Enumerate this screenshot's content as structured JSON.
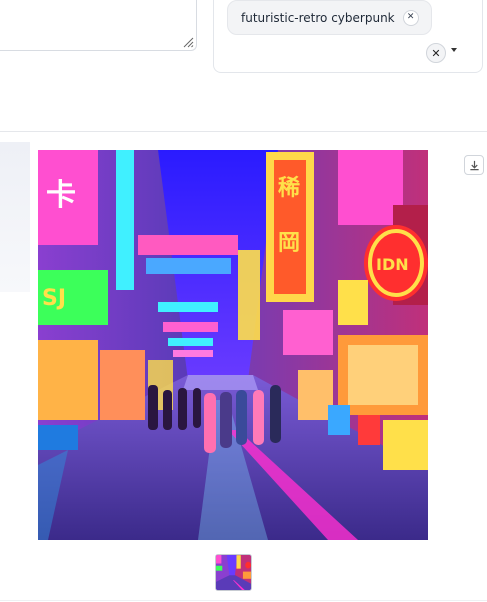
{
  "tags": {
    "items": [
      {
        "label": "futuristic-retro cyberpunk"
      }
    ]
  },
  "gallery": {
    "image_alt": "neon cyberpunk street",
    "thumbnail_count": 1
  },
  "colors": {
    "neon_pink": "#ff3fc8",
    "neon_yellow": "#ffe04a",
    "neon_cyan": "#40f0ff",
    "sky": "#3a2cff"
  }
}
